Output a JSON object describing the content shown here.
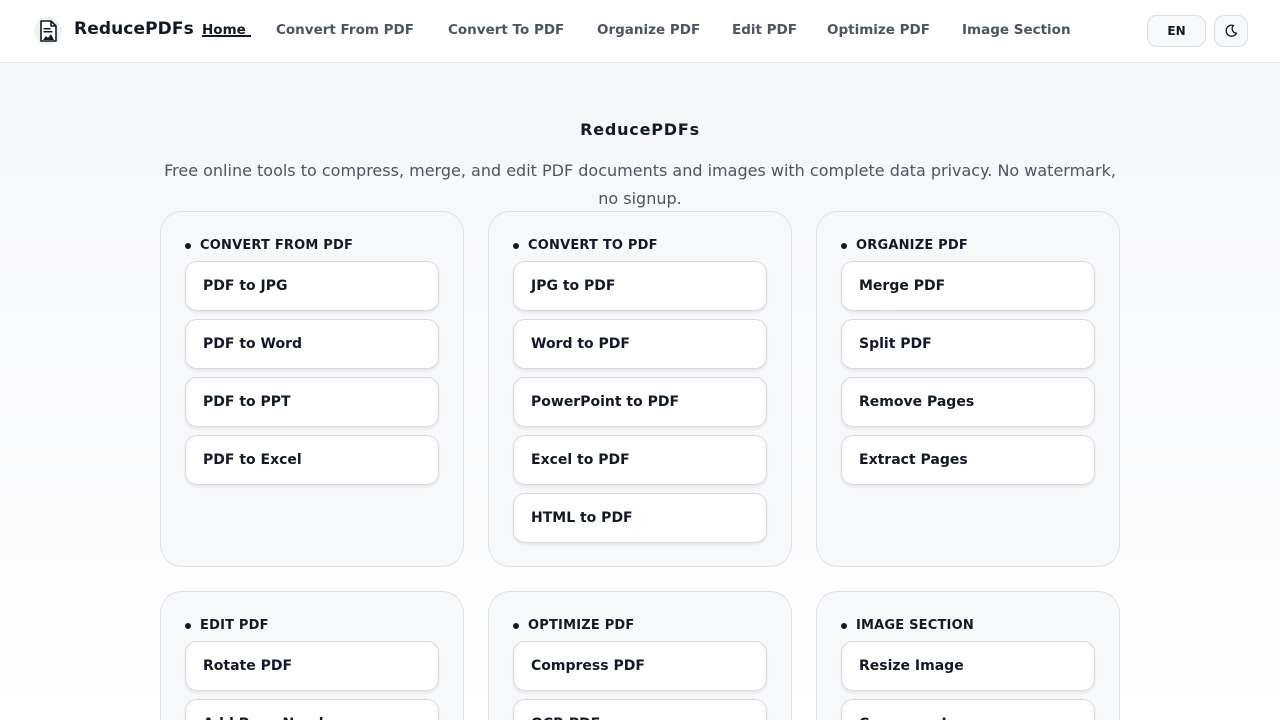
{
  "header": {
    "brand": "ReducePDFs",
    "nav": [
      "Home",
      "Convert From PDF",
      "Convert To PDF",
      "Organize PDF",
      "Edit PDF",
      "Optimize PDF",
      "Image Section"
    ],
    "active_nav": "Home",
    "lang": "EN",
    "theme_icon": "moon-icon"
  },
  "hero": {
    "title": "ReducePDFs",
    "subtitle": "Free online tools to compress, merge, and edit PDF documents and images with complete data privacy. No watermark, no signup."
  },
  "categories": [
    {
      "title": "CONVERT FROM PDF",
      "tools": [
        "PDF to JPG",
        "PDF to Word",
        "PDF to PPT",
        "PDF to Excel"
      ]
    },
    {
      "title": "CONVERT TO PDF",
      "tools": [
        "JPG to PDF",
        "Word to PDF",
        "PowerPoint to PDF",
        "Excel to PDF",
        "HTML to PDF"
      ]
    },
    {
      "title": "ORGANIZE PDF",
      "tools": [
        "Merge PDF",
        "Split PDF",
        "Remove Pages",
        "Extract Pages"
      ]
    },
    {
      "title": "EDIT PDF",
      "tools": [
        "Rotate PDF",
        "Add Page Numbers"
      ]
    },
    {
      "title": "OPTIMIZE PDF",
      "tools": [
        "Compress PDF",
        "OCR PDF"
      ]
    },
    {
      "title": "IMAGE SECTION",
      "tools": [
        "Resize Image",
        "Compress Image"
      ]
    }
  ],
  "colors": {
    "accent": "#111827",
    "muted_text": "#4b5563",
    "card_bg": "#f7f8fa",
    "border": "#dde1e7"
  }
}
